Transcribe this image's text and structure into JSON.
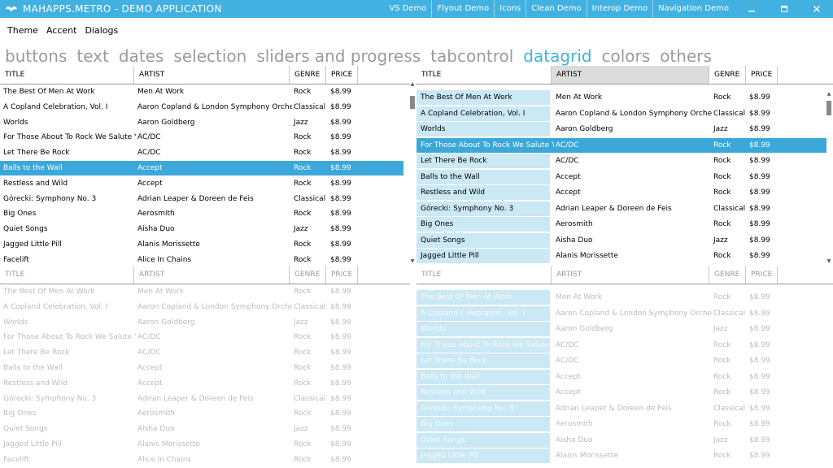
{
  "window": {
    "title": "MAHAPPS.METRO - DEMO APPLICATION",
    "commands": [
      "VS Demo",
      "Flyout Demo",
      "Icons",
      "Clean Demo",
      "Interop Demo",
      "Navigation Demo"
    ]
  },
  "menu": {
    "items": [
      "Theme",
      "Accent",
      "Dialogs"
    ]
  },
  "tabs": [
    "buttons",
    "text",
    "dates",
    "selection",
    "sliders and progress",
    "tabcontrol",
    "datagrid",
    "colors",
    "others"
  ],
  "selected_tab": "datagrid",
  "columns": {
    "title": "TITLE",
    "artist": "ARTIST",
    "genre": "GENRE",
    "price": "PRICE"
  },
  "albums": [
    {
      "title": "The Best Of Men At Work",
      "artist": "Men At Work",
      "genre": "Rock",
      "price": "$8.99"
    },
    {
      "title": "A Copland Celebration, Vol. I",
      "artist": "Aaron Copland & London Symphony Orchestra",
      "genre": "Classical",
      "price": "$8.99"
    },
    {
      "title": "Worlds",
      "artist": "Aaron Goldberg",
      "genre": "Jazz",
      "price": "$8.99"
    },
    {
      "title": "For Those About To Rock We Salute You",
      "artist": "AC/DC",
      "genre": "Rock",
      "price": "$8.99"
    },
    {
      "title": "Let There Be Rock",
      "artist": "AC/DC",
      "genre": "Rock",
      "price": "$8.99"
    },
    {
      "title": "Balls to the Wall",
      "artist": "Accept",
      "genre": "Rock",
      "price": "$8.99"
    },
    {
      "title": "Restless and Wild",
      "artist": "Accept",
      "genre": "Rock",
      "price": "$8.99"
    },
    {
      "title": "Górecki: Symphony No. 3",
      "artist": "Adrian Leaper & Doreen de Feis",
      "genre": "Classical",
      "price": "$8.99"
    },
    {
      "title": "Big Ones",
      "artist": "Aerosmith",
      "genre": "Rock",
      "price": "$8.99"
    },
    {
      "title": "Quiet Songs",
      "artist": "Aisha Duo",
      "genre": "Jazz",
      "price": "$8.99"
    },
    {
      "title": "Jagged Little Pill",
      "artist": "Alanis Morissette",
      "genre": "Rock",
      "price": "$8.99"
    },
    {
      "title": "Facelift",
      "artist": "Alice In Chains",
      "genre": "Rock",
      "price": "$8.99"
    }
  ],
  "grids": [
    {
      "name": "grid-top-left",
      "rows_shown": 12,
      "selected_row": 5,
      "dim": false,
      "row_header": false
    },
    {
      "name": "grid-top-right",
      "rows_shown": 11,
      "selected_row": 3,
      "dim": false,
      "row_header": true
    },
    {
      "name": "grid-bottom-left",
      "rows_shown": 12,
      "selected_row": -1,
      "dim": true,
      "row_header": false
    },
    {
      "name": "grid-bottom-right",
      "rows_shown": 11,
      "selected_row": -1,
      "dim": true,
      "row_header": true
    }
  ],
  "colors": {
    "accent": "#41b1e1",
    "selection": "#3ca8d9",
    "row_header": "#cbe8f5"
  }
}
